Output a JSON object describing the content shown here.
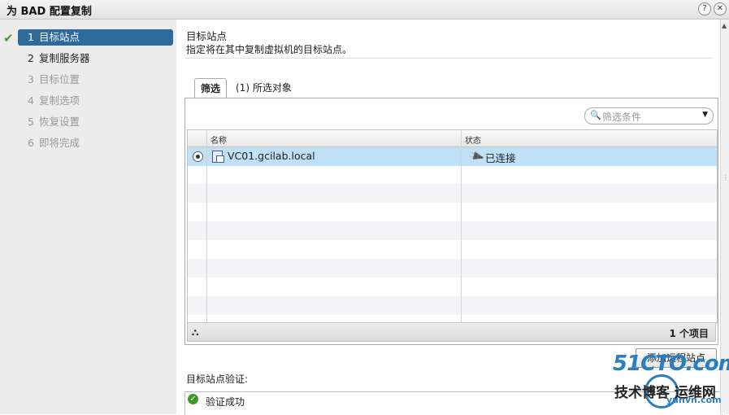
{
  "window": {
    "title": "为 BAD 配置复制",
    "help_icon": "?",
    "close_icon": "✕"
  },
  "steps": [
    {
      "num": "1",
      "label": "目标站点",
      "state": "active"
    },
    {
      "num": "2",
      "label": "复制服务器",
      "state": "done"
    },
    {
      "num": "3",
      "label": "目标位置",
      "state": "pending"
    },
    {
      "num": "4",
      "label": "复制选项",
      "state": "pending"
    },
    {
      "num": "5",
      "label": "恢复设置",
      "state": "pending"
    },
    {
      "num": "6",
      "label": "即将完成",
      "state": "pending"
    }
  ],
  "header": {
    "title": "目标站点",
    "subtitle": "指定将在其中复制虚拟机的目标站点。"
  },
  "tabs": [
    {
      "label": "筛选"
    },
    {
      "label": "(1) 所选对象"
    }
  ],
  "filter": {
    "placeholder": "筛选条件"
  },
  "table": {
    "columns": [
      "名称",
      "状态"
    ],
    "rows": [
      {
        "name": "VC01.gcilab.local",
        "status": "已连接",
        "selected": true
      }
    ],
    "footer_count": "1 个项目"
  },
  "add_button": "添加远程站点",
  "validation": {
    "label": "目标站点验证:",
    "result": "验证成功"
  },
  "watermark": {
    "line1": "51CTO.com",
    "line2": "技术博客",
    "line3": "运维网",
    "url": "yunvn.com"
  },
  "colors": {
    "active_step": "#2f6a9c",
    "selected_row": "#bfe0f6",
    "success": "#3a9a2a"
  }
}
